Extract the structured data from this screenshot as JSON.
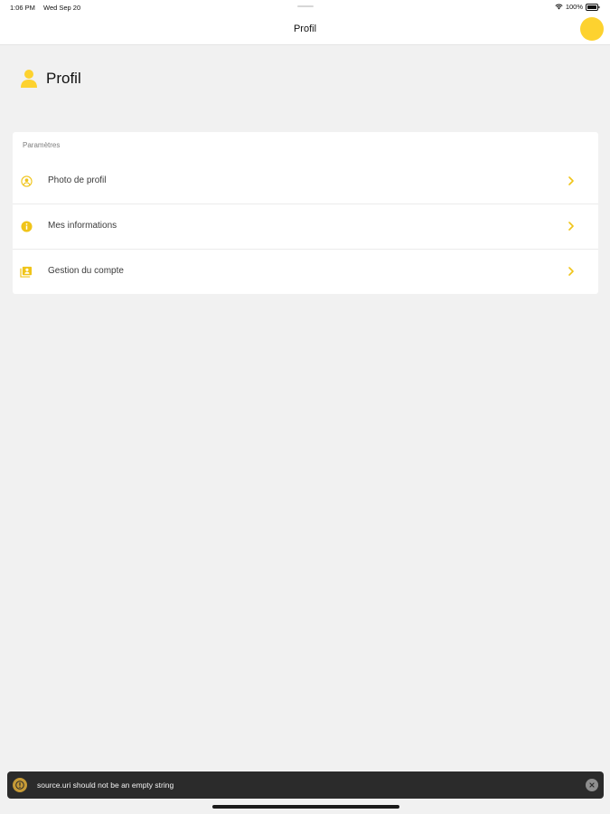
{
  "status": {
    "time": "1:06 PM",
    "date": "Wed Sep 20",
    "battery": "100%"
  },
  "nav": {
    "title": "Profil"
  },
  "header": {
    "title": "Profil",
    "icon": "user-icon"
  },
  "settings": {
    "section_label": "Paramètres",
    "items": [
      {
        "label": "Photo de profil",
        "icon": "user-circle-icon"
      },
      {
        "label": "Mes informations",
        "icon": "info-icon"
      },
      {
        "label": "Gestion du compte",
        "icon": "contact-card-icon"
      }
    ]
  },
  "toast": {
    "message": "source.uri should not be an empty string",
    "icon": "warning-icon"
  },
  "colors": {
    "accent": "#fdd22f",
    "background": "#f1f1f1",
    "toast": "#2b2b2b"
  }
}
